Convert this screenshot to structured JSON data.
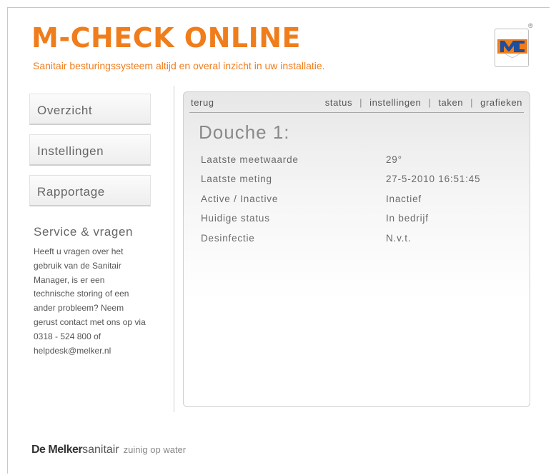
{
  "header": {
    "title": "M-CHECK ONLINE",
    "subtitle": "Sanitair besturingssysteem altijd en overal inzicht in uw installatie.",
    "logo_text": "M",
    "registered_mark": "®"
  },
  "sidebar": {
    "items": [
      {
        "label": "Overzicht"
      },
      {
        "label": "Instellingen"
      },
      {
        "label": "Rapportage"
      }
    ],
    "service": {
      "title": "Service & vragen",
      "text": "Heeft u vragen over het gebruik van de Sanitair Manager, is er een technische storing of een ander probleem? Neem gerust contact met ons op via 0318 - 524 800 of helpdesk@melker.nl"
    }
  },
  "panel": {
    "nav": {
      "back": "terug",
      "links": [
        "status",
        "instellingen",
        "taken",
        "grafieken"
      ]
    },
    "title": "Douche 1:",
    "rows": [
      {
        "key": "Laatste meetwaarde",
        "value": "29°"
      },
      {
        "key": "Laatste meting",
        "value": "27-5-2010 16:51:45"
      },
      {
        "key": "Active / Inactive",
        "value": "Inactief"
      },
      {
        "key": "Huidige status",
        "value": "In bedrijf"
      },
      {
        "key": "Desinfectie",
        "value": "N.v.t."
      }
    ]
  },
  "footer": {
    "brand_bold": "De Melker",
    "brand_light": "sanitair",
    "tagline": "zuinig op water"
  },
  "colors": {
    "accent": "#f07d1c",
    "logo_blue": "#1f4e9c"
  }
}
